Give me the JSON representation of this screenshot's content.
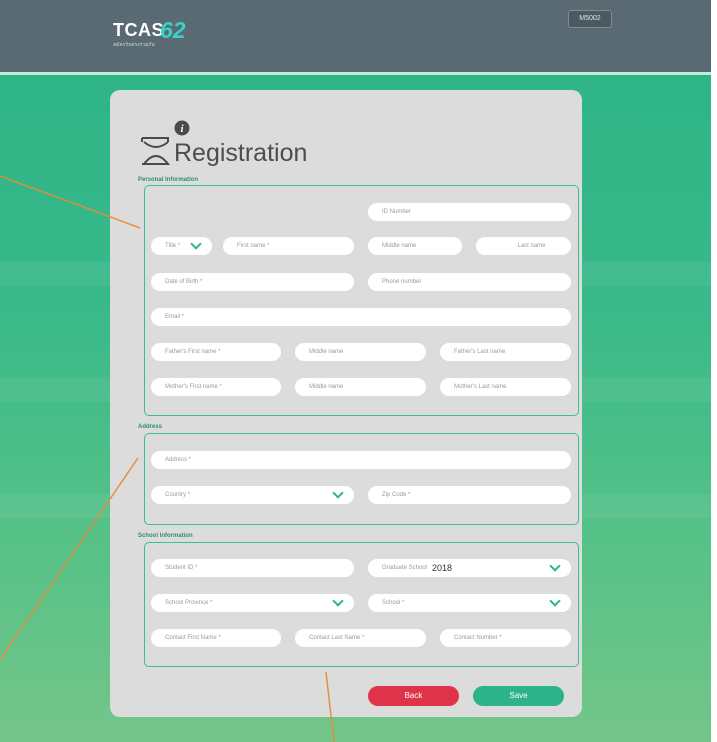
{
  "header": {
    "logo_text": "TCAS",
    "logo_number": "62",
    "logo_subtitle": "สมัครรับตรงร่วมกัน",
    "code_button": "M5002"
  },
  "page_title": "Registration",
  "sections": {
    "personal": {
      "label": "Personal Information",
      "id_number": "ID Number",
      "title_select": "Title *",
      "first_name": "First name *",
      "middle_name": "Middle name",
      "last_name": "Last name",
      "dob": "Date of Birth *",
      "phone": "Phone number",
      "email": "Email *",
      "father_first": "Father's First name *",
      "father_middle": "Middle name",
      "father_last": "Father's Last name",
      "mother_first": "Mother's First name *",
      "mother_middle": "Middle name",
      "mother_last": "Mother's Last name"
    },
    "address": {
      "label": "Address",
      "address": "Address *",
      "country": "Country *",
      "zip": "Zip Code *"
    },
    "school": {
      "label": "School Information",
      "student_id": "Student ID *",
      "graduate_school": "Graduate School",
      "graduate_year": "2018",
      "school_province": "School Province *",
      "school": "School *",
      "contact_first": "Contact First Name *",
      "contact_last": "Contact Last Name *",
      "contact_number": "Contact Number *"
    }
  },
  "buttons": {
    "back": "Back",
    "save": "Save"
  },
  "colors": {
    "header_bg": "#5a6a73",
    "accent": "#2cb38a",
    "back": "#df3349",
    "card": "#dcdcdc"
  }
}
